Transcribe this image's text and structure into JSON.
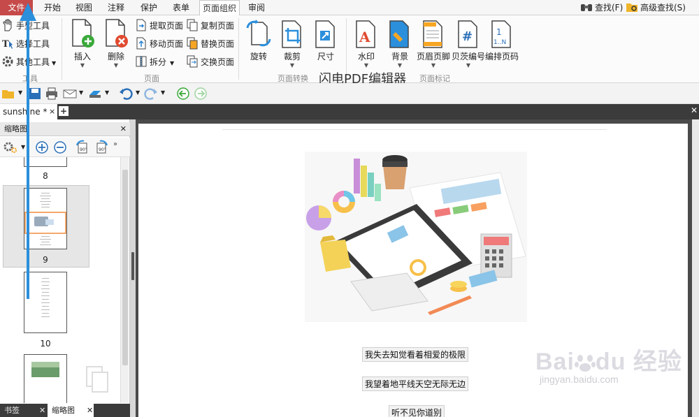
{
  "menu": {
    "file": "文件",
    "tabs": [
      "开始",
      "视图",
      "注释",
      "保护",
      "表单",
      "页面组织",
      "审阅"
    ],
    "active_tab": "页面组织",
    "find": "查找(F)",
    "advanced_find": "高级查找(S)"
  },
  "ribbon": {
    "tools": {
      "hand": "手型工具",
      "select": "选择工具",
      "other": "其他工具",
      "group": "工具"
    },
    "page_group": {
      "insert": "插入",
      "delete": "删除",
      "extract": "提取页面",
      "move": "移动页面",
      "split": "拆分",
      "copy": "复制页面",
      "replace": "替换页面",
      "swap": "交换页面",
      "label": "页面"
    },
    "transform_group": {
      "rotate": "旋转",
      "crop": "裁剪",
      "size": "尺寸",
      "label": "页面转换"
    },
    "mark_group": {
      "watermark": "水印",
      "background": "背景",
      "header_footer": "页眉页脚",
      "bates": "贝茨编号",
      "page_number": "编排页码",
      "label": "页面标记"
    },
    "app_title": "闪电PDF编辑器"
  },
  "doc_tab": {
    "name": "sunshine *",
    "close": "×"
  },
  "panel": {
    "title": "缩略图",
    "thumbnails": [
      "8",
      "9",
      "10"
    ],
    "selected": "9",
    "bottom_tabs": [
      "书签",
      "缩略图"
    ]
  },
  "page": {
    "captions": [
      "我失去知觉看着相爱的极限",
      "我望着地平线天空无际无边",
      "听不见你道别"
    ]
  },
  "watermark": {
    "logo": "Bai",
    "logo_suffix": "du",
    "logo_cn": "经验",
    "url": "jingyan.baidu.com"
  },
  "colors": {
    "file_menu": "#c64a4a",
    "arrow": "#2b8fdc",
    "dark_bar": "#3b3b3b"
  }
}
